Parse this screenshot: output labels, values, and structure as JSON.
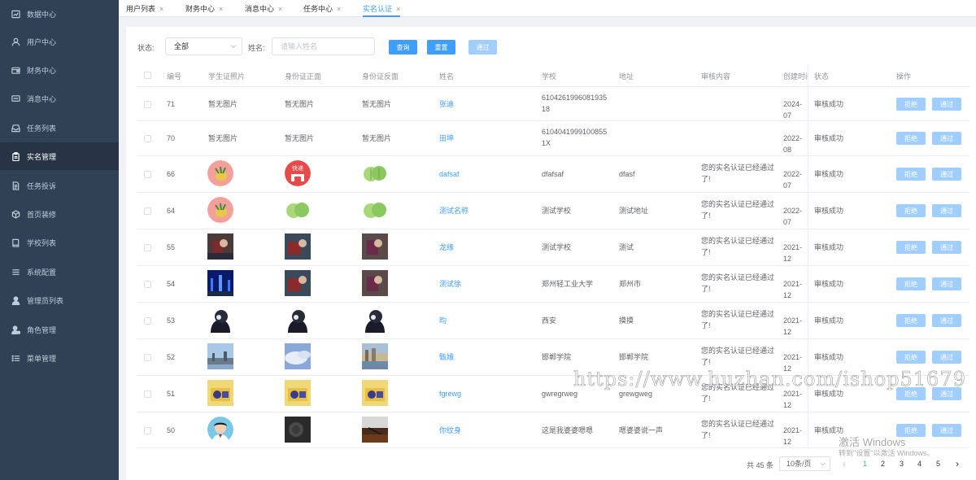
{
  "sidebar": {
    "items": [
      {
        "label": "数据中心",
        "icon": "chart-icon"
      },
      {
        "label": "用户中心",
        "icon": "user-icon"
      },
      {
        "label": "财务中心",
        "icon": "wallet-icon"
      },
      {
        "label": "消息中心",
        "icon": "message-icon"
      },
      {
        "label": "任务列表",
        "icon": "inbox-icon"
      },
      {
        "label": "实名管理",
        "icon": "clipboard-icon"
      },
      {
        "label": "任务投诉",
        "icon": "document-icon"
      },
      {
        "label": "首页装修",
        "icon": "box-icon"
      },
      {
        "label": "学校列表",
        "icon": "book-icon"
      },
      {
        "label": "系统配置",
        "icon": "list-icon"
      },
      {
        "label": "管理员列表",
        "icon": "person-icon"
      },
      {
        "label": "角色管理",
        "icon": "person-lock-icon"
      },
      {
        "label": "菜单管理",
        "icon": "menu-list-icon"
      }
    ],
    "active_index": 5
  },
  "tabs": [
    {
      "label": "用户列表",
      "close": "×"
    },
    {
      "label": "财务中心",
      "close": "×"
    },
    {
      "label": "消息中心",
      "close": "×"
    },
    {
      "label": "任务中心",
      "close": "×"
    },
    {
      "label": "实名认证",
      "close": "×"
    }
  ],
  "filter": {
    "status_label": "状态:",
    "status_value": "全部",
    "name_label": "姓名:",
    "name_placeholder": "请输入姓名",
    "query_button": "查询",
    "reset_button": "重置",
    "approve_button": "通过"
  },
  "table": {
    "headers": [
      "编号",
      "学生证照片",
      "身份证正面",
      "身份证反面",
      "姓名",
      "学校",
      "地址",
      "审核内容",
      "创建时间",
      "状态",
      "操作"
    ],
    "rows": [
      {
        "id": "71",
        "student_card": "暂无图片",
        "id_front": "暂无图片",
        "id_back": "暂无图片",
        "name": "张迪",
        "school": [
          "6104261996081935",
          "18"
        ],
        "address": "",
        "review": [
          "",
          ""
        ],
        "created": "2024-07",
        "status": "审核成功"
      },
      {
        "id": "70",
        "student_card": "暂无图片",
        "id_front": "暂无图片",
        "id_back": "暂无图片",
        "name": "田坤",
        "school": [
          "6104041999100855",
          "1X"
        ],
        "address": "",
        "review": [
          "",
          ""
        ],
        "created": "2022-08",
        "status": "审核成功"
      },
      {
        "id": "66",
        "student_card": "",
        "id_front": "",
        "id_back": "",
        "name": "dafsaf",
        "school": [
          "dfafsaf",
          ""
        ],
        "address": "dfasf",
        "review": [
          "您的实名认证已经通过",
          "了!"
        ],
        "created": "2022-07",
        "status": "审核成功",
        "stamp": "快递"
      },
      {
        "id": "64",
        "student_card": "",
        "id_front": "",
        "id_back": "",
        "name": "测试名称",
        "school": [
          "测试学校",
          ""
        ],
        "address": "测试地址",
        "review": [
          "您的实名认证已经通过",
          "了!"
        ],
        "created": "2022-07",
        "status": "审核成功"
      },
      {
        "id": "55",
        "student_card": "",
        "id_front": "",
        "id_back": "",
        "name": "龙缘",
        "school": [
          "测试学校",
          ""
        ],
        "address": "测试",
        "review": [
          "您的实名认证已经通过",
          "了!"
        ],
        "created": "2021-12",
        "status": "审核成功"
      },
      {
        "id": "54",
        "student_card": "",
        "id_front": "",
        "id_back": "",
        "name": "测试徐",
        "school": [
          "郑州轻工业大学",
          ""
        ],
        "address": "郑州市",
        "review": [
          "您的实名认证已经通过",
          "了!"
        ],
        "created": "2021-12",
        "status": "审核成功"
      },
      {
        "id": "53",
        "student_card": "",
        "id_front": "",
        "id_back": "",
        "name": "昀",
        "school": [
          "西安",
          ""
        ],
        "address": "摸摸",
        "review": [
          "您的实名认证已经通过",
          "了!"
        ],
        "created": "2021-12",
        "status": "审核成功"
      },
      {
        "id": "52",
        "student_card": "",
        "id_front": "",
        "id_back": "",
        "name": "甄嬛",
        "school": [
          "邯郸学院",
          ""
        ],
        "address": "邯郸学院",
        "review": [
          "您的实名认证已经通过",
          "了!"
        ],
        "created": "2021-12",
        "status": "审核成功"
      },
      {
        "id": "51",
        "student_card": "",
        "id_front": "",
        "id_back": "",
        "name": "fgrewg",
        "school": [
          "gwregrweg",
          ""
        ],
        "address": "grewgweg",
        "review": [
          "您的实名认证已经通过",
          "了!"
        ],
        "created": "2021-12",
        "status": "审核成功"
      },
      {
        "id": "50",
        "student_card": "",
        "id_front": "",
        "id_back": "",
        "name": "你纹身",
        "school": [
          "这是我婆婆嗯嗯",
          ""
        ],
        "address": "嗯婆婆说一声",
        "review": [
          "您的实名认证已经通过",
          "了!"
        ],
        "created": "2021-12",
        "status": "审核成功"
      }
    ],
    "reject_label": "拒绝",
    "approve_label": "通过"
  },
  "pagination": {
    "total": "共 45 条",
    "page_size": "10条/页",
    "prev": "‹",
    "pages": [
      "1",
      "2",
      "3",
      "4",
      "5"
    ],
    "next": "›",
    "current": "1"
  },
  "watermark": "https://www.huzhan.com/ishop51679",
  "windows_notice": {
    "title": "激活 Windows",
    "subtitle": "转到\"设置\"以激活 Windows。"
  },
  "colors": {
    "sidebar_bg": "#304156",
    "primary": "#409eff",
    "primary_light": "#a0cfff"
  }
}
